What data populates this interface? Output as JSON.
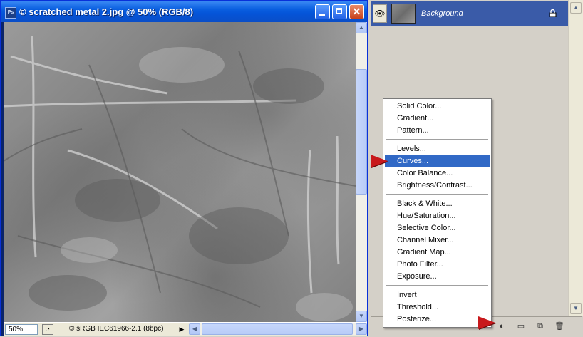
{
  "document": {
    "title": "© scratched metal 2.jpg @ 50% (RGB/8)",
    "app_icon": "Ps",
    "zoom": "50%",
    "color_profile": "© sRGB IEC61966-2.1 (8bpc)"
  },
  "layers": {
    "items": [
      {
        "name": "Background",
        "visible": true,
        "locked": true
      }
    ]
  },
  "menu": {
    "groups": [
      [
        "Solid Color...",
        "Gradient...",
        "Pattern..."
      ],
      [
        "Levels...",
        "Curves...",
        "Color Balance...",
        "Brightness/Contrast..."
      ],
      [
        "Black & White...",
        "Hue/Saturation...",
        "Selective Color...",
        "Channel Mixer...",
        "Gradient Map...",
        "Photo Filter...",
        "Exposure..."
      ],
      [
        "Invert",
        "Threshold...",
        "Posterize..."
      ]
    ],
    "highlighted": "Curves..."
  },
  "icons": {
    "eye": "eye-icon",
    "lock": "lock-icon",
    "adjustment": "adjustment-layer-icon",
    "group": "folder-icon",
    "new_layer": "new-layer-icon",
    "delete": "trash-icon"
  },
  "colors": {
    "title_bar": "#0a5fe0",
    "selection": "#3169c6",
    "layer_row": "#3a5ba8",
    "annotation_arrow": "#c8191c"
  }
}
